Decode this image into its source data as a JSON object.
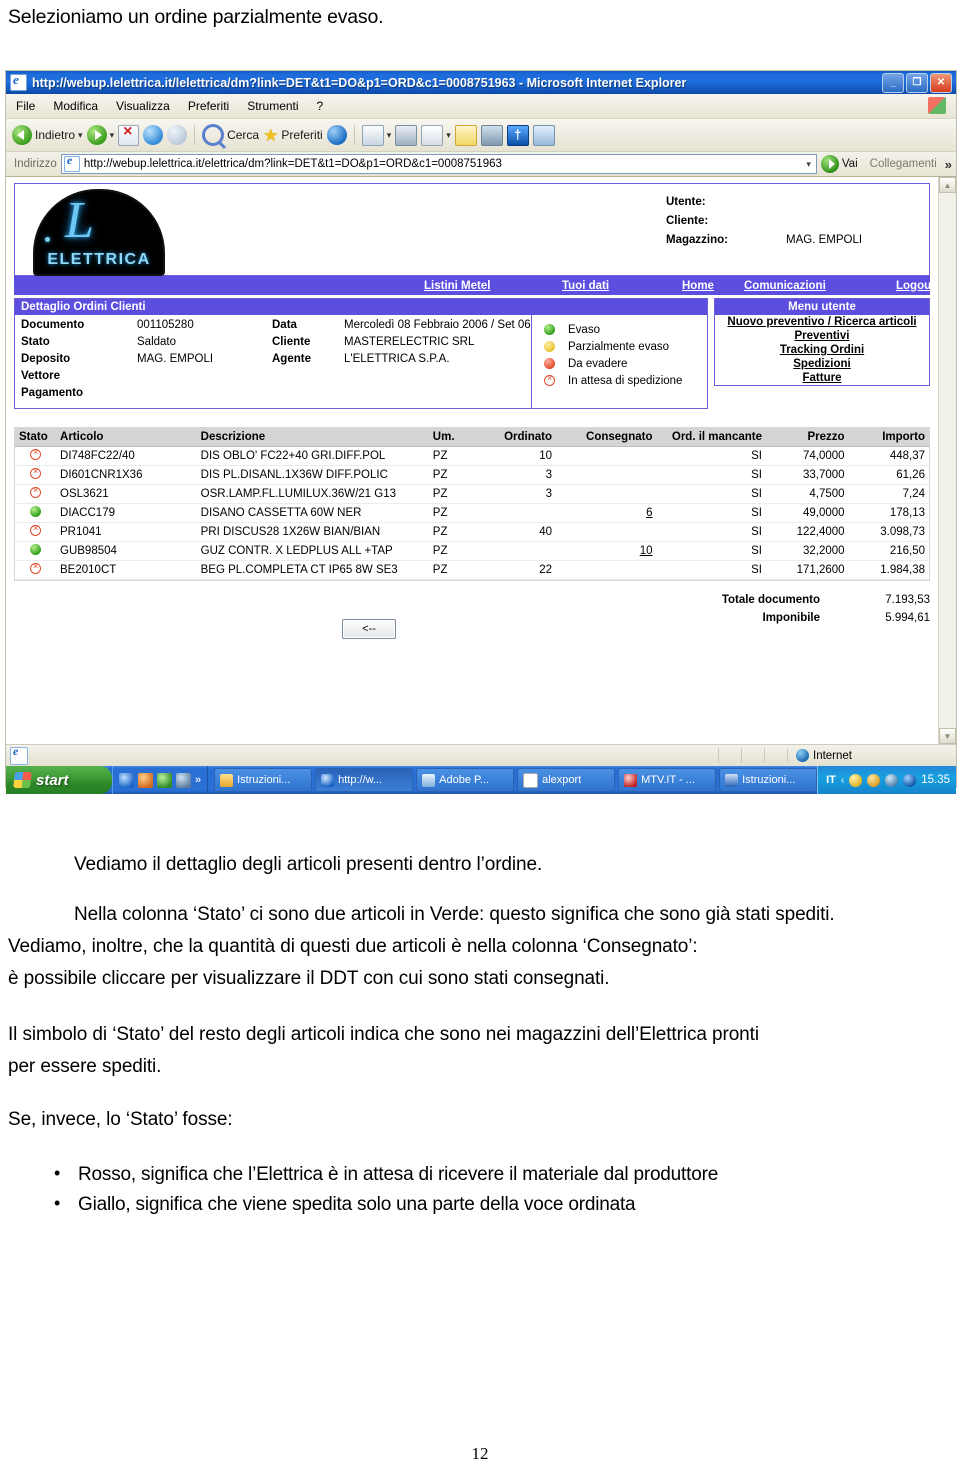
{
  "document": {
    "intro": "Selezioniamo un ordine parzialmente evaso.",
    "paragraphs": [
      "Vediamo il dettaglio degli articoli presenti dentro l’ordine.",
      "Nella colonna ‘Stato’ ci sono due articoli in Verde: questo significa che sono già stati spediti.",
      "Vediamo, inoltre, che la quantità di questi due articoli è nella colonna ‘Consegnato’:",
      "è possibile cliccare per visualizzare il DDT con cui sono stati consegnati.",
      "Il simbolo di ‘Stato’ del resto degli articoli indica che sono nei magazzini dell’Elettrica pronti",
      "per essere spediti.",
      "Se, invece, lo ‘Stato’ fosse:"
    ],
    "bullets": [
      "Rosso, significa che l’Elettrica è in attesa di ricevere il materiale dal produttore",
      "Giallo, significa che viene spedita solo una parte della voce ordinata"
    ],
    "page_number": "12"
  },
  "browser": {
    "title": "http://webup.lelettrica.it/lelettrica/dm?link=DET&t1=DO&p1=ORD&c1=0008751963 - Microsoft Internet Explorer",
    "window_buttons": {
      "minimize": "_",
      "maximize": "❐",
      "close": "✕"
    },
    "menu": [
      "File",
      "Modifica",
      "Visualizza",
      "Preferiti",
      "Strumenti",
      "?"
    ],
    "toolbar": {
      "back": "Indietro",
      "forward": "",
      "search": "Cerca",
      "favorites": "Preferiti",
      "dropdown_caret": "▾"
    },
    "address": {
      "label": "Indirizzo",
      "url": "http://webup.lelettrica.it/elettrica/dm?link=DET&t1=DO&p1=ORD&c1=0008751963",
      "go_label": "Vai",
      "links_label": "Collegamenti",
      "chevron": "»"
    },
    "statusbar": {
      "zone": "Internet"
    }
  },
  "taskbar": {
    "start_label": "start",
    "quicklaunch_more": "»",
    "tasks": [
      {
        "label": "Istruzioni...",
        "icon": "folder-icon"
      },
      {
        "label": "http://w...",
        "icon": "ie-icon"
      },
      {
        "label": "Adobe P...",
        "icon": "adobe-icon"
      },
      {
        "label": "alexport",
        "icon": "app-icon"
      },
      {
        "label": "MTV.IT - ...",
        "icon": "mtv-icon"
      },
      {
        "label": "Istruzioni...",
        "icon": "word-icon"
      }
    ],
    "tray": {
      "language": "IT",
      "chevron": "‹",
      "time": "15.35"
    }
  },
  "app": {
    "logo": {
      "script_letter": "L",
      "word": "ELETTRICA"
    },
    "userinfo": [
      {
        "label": "Utente:",
        "value": ""
      },
      {
        "label": "Cliente:",
        "value": ""
      },
      {
        "label": "Magazzino:",
        "value": "MAG. EMPOLI"
      }
    ],
    "nav": [
      {
        "label": "Listini Metel"
      },
      {
        "label": "Tuoi dati"
      },
      {
        "label": "Home"
      },
      {
        "label": "Comunicazioni"
      },
      {
        "label": "Logout"
      }
    ],
    "detail": {
      "title": "Dettaglio Ordini Clienti",
      "fields": [
        {
          "k": "Documento",
          "v": "001105280",
          "k2": "Data",
          "v2": "Mercoledì 08 Febbraio 2006 / Set 06"
        },
        {
          "k": "Stato",
          "v": "Saldato",
          "k2": "Cliente",
          "v2": "MASTERELECTRIC SRL"
        },
        {
          "k": "Deposito",
          "v": "MAG. EMPOLI",
          "k2": "Agente",
          "v2": "L'ELETTRICA S.P.A."
        },
        {
          "k": "Vettore",
          "v": "",
          "k2": "",
          "v2": ""
        },
        {
          "k": "Pagamento",
          "v": "",
          "k2": "",
          "v2": ""
        }
      ],
      "legend": [
        {
          "color": "green",
          "label": "Evaso"
        },
        {
          "color": "yellow",
          "label": "Parzialmente evaso"
        },
        {
          "color": "red",
          "label": "Da evadere"
        },
        {
          "color": "wait",
          "label": "In attesa di spedizione"
        }
      ]
    },
    "user_menu": {
      "title": "Menu utente",
      "items": [
        "Nuovo preventivo / Ricerca articoli",
        "Preventivi",
        "Tracking Ordini",
        "Spedizioni",
        "Fatture"
      ]
    },
    "articles": {
      "headers": {
        "stato": "Stato",
        "articolo": "Articolo",
        "descrizione": "Descrizione",
        "um": "Um.",
        "ordinato": "Ordinato",
        "consegnato": "Consegnato",
        "mancante": "Ord. il mancante",
        "prezzo": "Prezzo",
        "importo": "Importo"
      },
      "rows": [
        {
          "stato": "wait",
          "articolo": "DI748FC22/40",
          "descrizione": "DIS OBLO' FC22+40 GRI.DIFF.POL",
          "um": "PZ",
          "ordinato": "10",
          "consegnato": "",
          "mancante": "SI",
          "prezzo": "74,0000",
          "importo": "448,37"
        },
        {
          "stato": "wait",
          "articolo": "DI601CNR1X36",
          "descrizione": "DIS PL.DISANL.1X36W DIFF.POLIC",
          "um": "PZ",
          "ordinato": "3",
          "consegnato": "",
          "mancante": "SI",
          "prezzo": "33,7000",
          "importo": "61,26"
        },
        {
          "stato": "wait",
          "articolo": "OSL3621",
          "descrizione": "OSR.LAMP.FL.LUMILUX.36W/21 G13",
          "um": "PZ",
          "ordinato": "3",
          "consegnato": "",
          "mancante": "SI",
          "prezzo": "4,7500",
          "importo": "7,24"
        },
        {
          "stato": "green",
          "articolo": "DIACC179",
          "descrizione": "DISANO CASSETTA 60W NER",
          "um": "PZ",
          "ordinato": "",
          "consegnato": "6",
          "mancante": "SI",
          "prezzo": "49,0000",
          "importo": "178,13"
        },
        {
          "stato": "wait",
          "articolo": "PR1041",
          "descrizione": "PRI DISCUS28 1X26W BIAN/BIAN",
          "um": "PZ",
          "ordinato": "40",
          "consegnato": "",
          "mancante": "SI",
          "prezzo": "122,4000",
          "importo": "3.098,73"
        },
        {
          "stato": "green",
          "articolo": "GUB98504",
          "descrizione": "GUZ CONTR. X LEDPLUS ALL +TAP",
          "um": "PZ",
          "ordinato": "",
          "consegnato": "10",
          "mancante": "SI",
          "prezzo": "32,2000",
          "importo": "216,50"
        },
        {
          "stato": "wait",
          "articolo": "BE2010CT",
          "descrizione": "BEG PL.COMPLETA CT IP65 8W SE3",
          "um": "PZ",
          "ordinato": "22",
          "consegnato": "",
          "mancante": "SI",
          "prezzo": "171,2600",
          "importo": "1.984,38"
        }
      ]
    },
    "totals": [
      {
        "label": "Totale documento",
        "value": "7.193,53"
      },
      {
        "label": "Imponibile",
        "value": "5.994,61"
      }
    ],
    "back_button": "<--"
  },
  "colors": {
    "accent_purple": "#5c4fe0",
    "title_blue": "#1f6fe0",
    "status_green": "#2f9e19",
    "status_yellow": "#e8c42e",
    "status_red": "#e04a2c",
    "table_header_gray": "#d5d5d5"
  }
}
